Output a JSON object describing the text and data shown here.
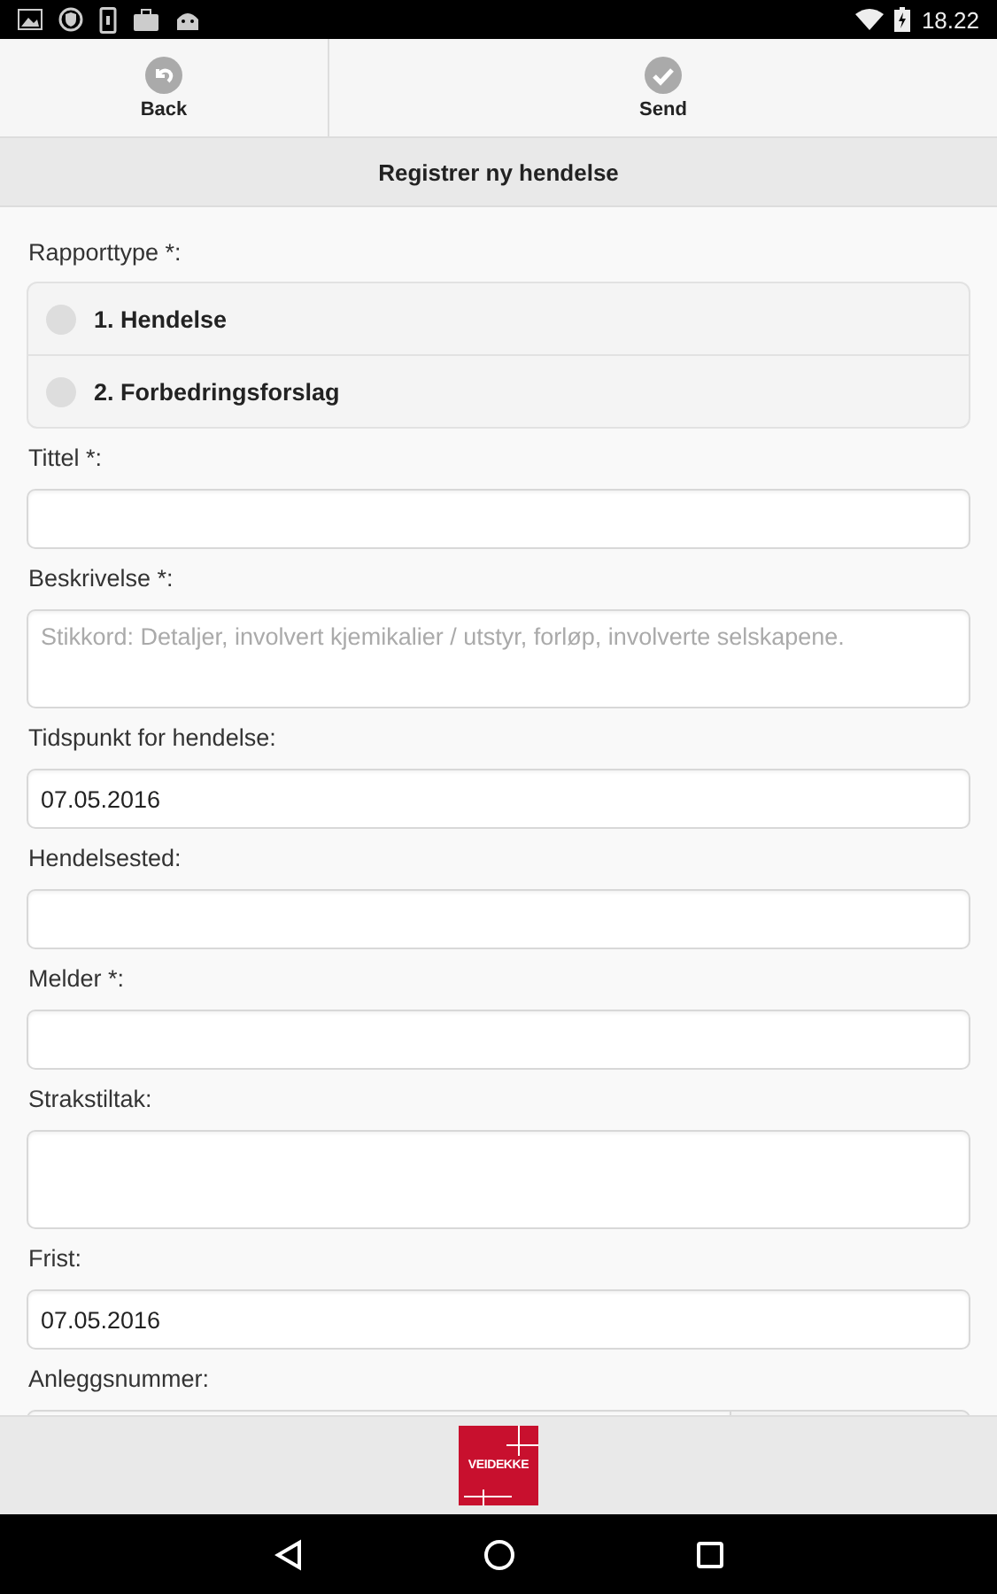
{
  "status_bar": {
    "time": "18.22"
  },
  "toolbar": {
    "buttons": [
      {
        "label": "Back",
        "kind": "back"
      },
      {
        "label": "Send",
        "kind": "send"
      }
    ]
  },
  "title": "Registrer ny hendelse",
  "report_type": {
    "label": "Rapporttype *:",
    "options": [
      {
        "label": "1. Hendelse",
        "selected": false
      },
      {
        "label": "2. Forbedringsforslag",
        "selected": false
      }
    ]
  },
  "fields": [
    {
      "label": "Tittel *:",
      "kind": "text"
    },
    {
      "label": "Beskrivelse *:",
      "kind": "textarea",
      "placeholder": "Stikkord: Detaljer, involvert kjemikalier / utstyr, forløp, involverte selskapene."
    },
    {
      "label": "Tidspunkt for hendelse:",
      "kind": "text",
      "value": "07.05.2016"
    },
    {
      "label": "Hendelsested:",
      "kind": "text"
    },
    {
      "label": "Melder *:",
      "kind": "text"
    },
    {
      "label": "Strakstiltak:",
      "kind": "textarea"
    },
    {
      "label": "Frist:",
      "kind": "text",
      "value": "07.05.2016"
    },
    {
      "label": "Anleggsnummer:",
      "kind": "lookup"
    }
  ],
  "footer": {
    "logo": "VEIDEKKE"
  }
}
